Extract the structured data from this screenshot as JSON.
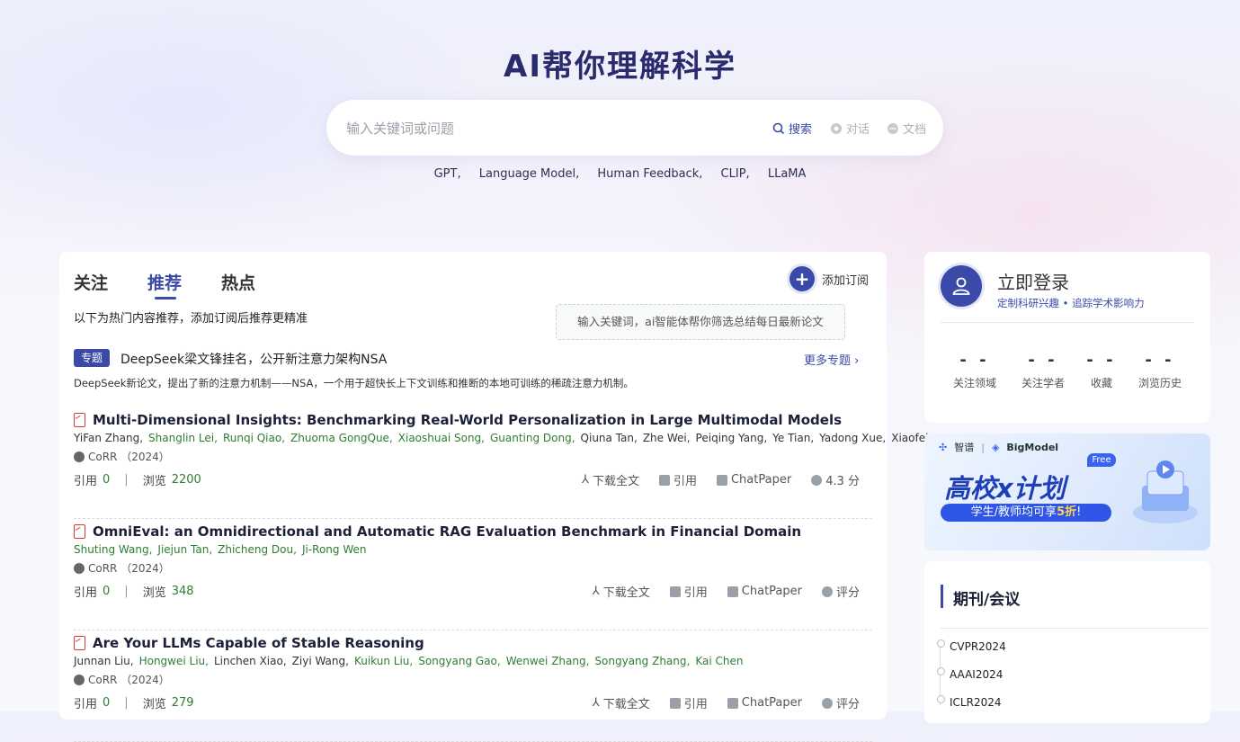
{
  "hero": {
    "title": "AI帮你理解科学",
    "search_placeholder": "输入关键词或问题",
    "modes": {
      "search": "搜索",
      "chat": "对话",
      "doc": "文档"
    },
    "hot_tags": [
      "GPT,",
      "Language Model,",
      "Human Feedback,",
      "CLIP,",
      "LLaMA"
    ]
  },
  "feed": {
    "tabs": [
      "关注",
      "推荐",
      "热点"
    ],
    "active_tab": "推荐",
    "add_subscription": "添加订阅",
    "tooltip": "输入关键词，ai智能体帮你筛选总结每日最新论文",
    "intro": "以下为热门内容推荐，添加订阅后推荐更精准",
    "topic": {
      "badge": "专题",
      "title": "DeepSeek梁文锋挂名，公开新注意力架构NSA",
      "more": "更多专题",
      "desc": "DeepSeek新论文，提出了新的注意力机制——NSA，一个用于超快长上下文训练和推断的本地可训练的稀疏注意力机制。"
    },
    "labels": {
      "cite": "引用",
      "view": "浏览",
      "download": "下载全文",
      "quote": "引用",
      "chatpaper": "ChatPaper",
      "rate": "评分"
    },
    "papers": [
      {
        "title": "Multi-Dimensional Insights: Benchmarking Real-World Personalization in Large Multimodal Models",
        "authors": [
          {
            "name": "YiFan Zhang,",
            "link": false
          },
          {
            "name": "Shanglin Lei,",
            "link": true
          },
          {
            "name": "Runqi Qiao,",
            "link": true
          },
          {
            "name": "Zhuoma GongQue,",
            "link": true
          },
          {
            "name": "Xiaoshuai Song,",
            "link": true
          },
          {
            "name": "Guanting Dong,",
            "link": true
          },
          {
            "name": "Qiuna Tan,",
            "link": false
          },
          {
            "name": "Zhe Wei,",
            "link": false
          },
          {
            "name": "Peiqing Yang,",
            "link": false
          },
          {
            "name": "Ye Tian,",
            "link": false
          },
          {
            "name": "Yadong Xue,",
            "link": false
          },
          {
            "name": "Xiaofei Wang,",
            "link": false
          }
        ],
        "venue": "CoRR （2024）",
        "cites": "0",
        "views": "2200",
        "rating": "4.3 分"
      },
      {
        "title": "OmniEval: an Omnidirectional and Automatic RAG Evaluation Benchmark in Financial Domain",
        "authors": [
          {
            "name": "Shuting Wang,",
            "link": true
          },
          {
            "name": "Jiejun Tan,",
            "link": true
          },
          {
            "name": "Zhicheng Dou,",
            "link": true
          },
          {
            "name": "Ji-Rong Wen",
            "link": true
          }
        ],
        "venue": "CoRR （2024）",
        "cites": "0",
        "views": "348",
        "rating": "评分"
      },
      {
        "title": "Are Your LLMs Capable of Stable Reasoning",
        "authors": [
          {
            "name": "Junnan Liu,",
            "link": false
          },
          {
            "name": "Hongwei Liu,",
            "link": true
          },
          {
            "name": "Linchen Xiao,",
            "link": false
          },
          {
            "name": "Ziyi Wang,",
            "link": false
          },
          {
            "name": "Kuikun Liu,",
            "link": true
          },
          {
            "name": "Songyang Gao,",
            "link": true
          },
          {
            "name": "Wenwei Zhang,",
            "link": true
          },
          {
            "name": "Songyang Zhang,",
            "link": true
          },
          {
            "name": "Kai Chen",
            "link": true
          }
        ],
        "venue": "CoRR （2024）",
        "cites": "0",
        "views": "279",
        "rating": "评分"
      }
    ]
  },
  "login": {
    "title": "立即登录",
    "subtitle": "定制科研兴趣 • 追踪学术影响力",
    "stats": [
      {
        "value": "- -",
        "label": "关注领域"
      },
      {
        "value": "- -",
        "label": "关注学者"
      },
      {
        "value": "- -",
        "label": "收藏"
      },
      {
        "value": "- -",
        "label": "浏览历史"
      }
    ]
  },
  "banner": {
    "brand1": "智谱",
    "brand2": "BigModel",
    "title": "高校x计划",
    "free": "Free",
    "pill_prefix": "学生/教师均可享",
    "pill_discount": "5折",
    "pill_suffix": "!"
  },
  "journals": {
    "title": "期刊/会议",
    "items": [
      "CVPR2024",
      "AAAI2024",
      "ICLR2024"
    ]
  },
  "colors": {
    "primary": "#3b4aa8",
    "link_green": "#2e7d32"
  }
}
